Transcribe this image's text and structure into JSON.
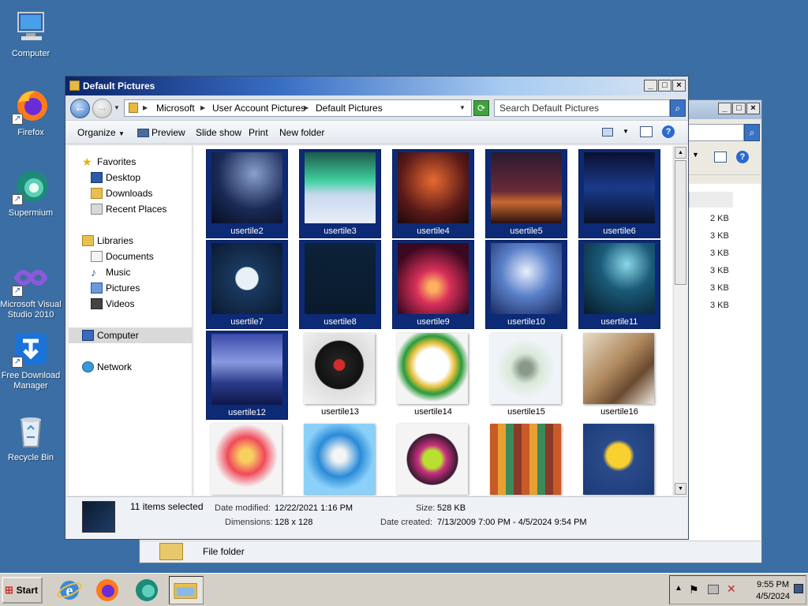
{
  "desktop_icons": [
    {
      "label": "Computer",
      "icon": "computer-icon"
    },
    {
      "label": "Firefox",
      "icon": "firefox-icon"
    },
    {
      "label": "Supermium",
      "icon": "supermium-icon"
    },
    {
      "label": "Microsoft Visual Studio 2010",
      "icon": "visual-studio-icon"
    },
    {
      "label": "Free Download Manager",
      "icon": "fdm-icon"
    },
    {
      "label": "Recycle Bin",
      "icon": "recycle-bin-icon"
    }
  ],
  "back_window": {
    "sizes": [
      "2 KB",
      "3 KB",
      "3 KB",
      "3 KB",
      "3 KB",
      "3 KB"
    ],
    "status": "File folder"
  },
  "window": {
    "title": "Default Pictures",
    "breadcrumb": [
      "Microsoft",
      "User Account Pictures",
      "Default Pictures"
    ],
    "search_placeholder": "Search Default Pictures",
    "toolbar": {
      "organize": "Organize",
      "preview": "Preview",
      "slideshow": "Slide show",
      "print": "Print",
      "new_folder": "New folder"
    },
    "nav": {
      "favorites": "Favorites",
      "desktop": "Desktop",
      "downloads": "Downloads",
      "recent_places": "Recent Places",
      "libraries": "Libraries",
      "documents": "Documents",
      "music": "Music",
      "pictures": "Pictures",
      "videos": "Videos",
      "computer": "Computer",
      "network": "Network"
    },
    "tiles": [
      {
        "name": "usertile2",
        "selected": true
      },
      {
        "name": "usertile3",
        "selected": true
      },
      {
        "name": "usertile4",
        "selected": true
      },
      {
        "name": "usertile5",
        "selected": true
      },
      {
        "name": "usertile6",
        "selected": true
      },
      {
        "name": "usertile7",
        "selected": true
      },
      {
        "name": "usertile8",
        "selected": true
      },
      {
        "name": "usertile9",
        "selected": true
      },
      {
        "name": "usertile10",
        "selected": true
      },
      {
        "name": "usertile11",
        "selected": true
      },
      {
        "name": "usertile12",
        "selected": true
      },
      {
        "name": "usertile13",
        "selected": false
      },
      {
        "name": "usertile14",
        "selected": false
      },
      {
        "name": "usertile15",
        "selected": false
      },
      {
        "name": "usertile16",
        "selected": false
      },
      {
        "name": "",
        "selected": false
      },
      {
        "name": "",
        "selected": false
      },
      {
        "name": "",
        "selected": false
      },
      {
        "name": "",
        "selected": false
      },
      {
        "name": "",
        "selected": false
      }
    ],
    "details": {
      "selected_count": "11 items selected",
      "date_modified_label": "Date modified:",
      "date_modified": "12/22/2021 1:16 PM",
      "size_label": "Size:",
      "size": "528 KB",
      "dimensions_label": "Dimensions:",
      "dimensions": "128 x 128",
      "date_created_label": "Date created:",
      "date_created": "7/13/2009 7:00 PM - 4/5/2024 9:54 PM"
    }
  },
  "taskbar": {
    "start": "Start",
    "time": "9:55 PM",
    "date": "4/5/2024"
  }
}
